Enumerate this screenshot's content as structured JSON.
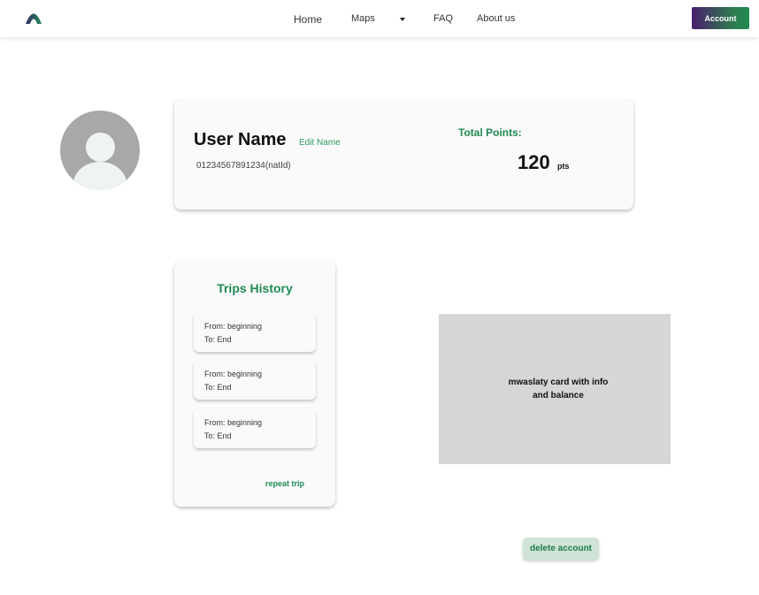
{
  "nav": {
    "links": [
      "Home",
      "Maps",
      "FAQ",
      "About us"
    ],
    "account_label": "Account",
    "brand_colors": {
      "primary_green": "#1f8a52",
      "gradient_purple": "#4a1d6e"
    }
  },
  "profile": {
    "user_name": "User Name",
    "edit_label": "Edit Name",
    "national_id": "01234567891234(natId)",
    "total_points_label": "Total Points:",
    "points_value": "120",
    "points_unit": "pts"
  },
  "trips": {
    "title": "Trips History",
    "items": [
      {
        "from": "From: beginning",
        "to": "To: End"
      },
      {
        "from": "From: beginning",
        "to": "To: End"
      },
      {
        "from": "From: beginning",
        "to": "To: End"
      }
    ],
    "repeat_label": "repeat trip"
  },
  "card": {
    "placeholder_text": "mwaslaty card with info\nand balance"
  },
  "actions": {
    "delete_label": "delete account"
  }
}
